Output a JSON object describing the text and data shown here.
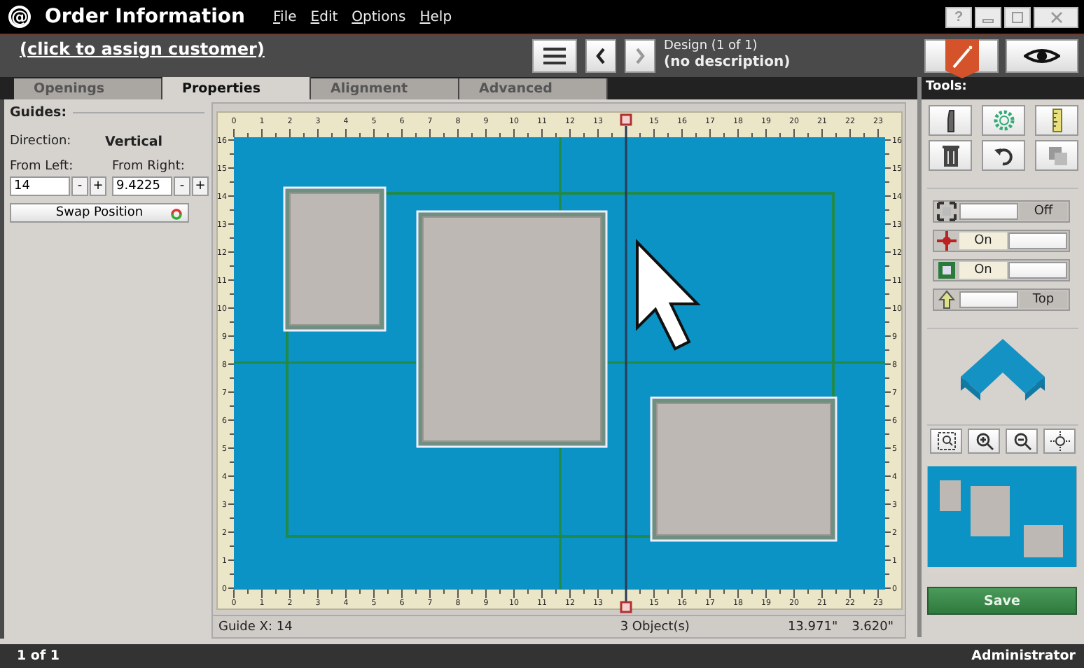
{
  "window": {
    "logo": "@",
    "title": "Order Information",
    "menu": [
      "File",
      "Edit",
      "Options",
      "Help"
    ],
    "help_button": "?"
  },
  "header": {
    "customer_link": "(click to assign customer)",
    "design_title": "Design  (1 of 1)",
    "design_description": "(no description)"
  },
  "tabs": [
    {
      "label": "Openings",
      "selected": false
    },
    {
      "label": "Properties",
      "selected": true
    },
    {
      "label": "Alignment",
      "selected": false
    },
    {
      "label": "Advanced",
      "selected": false
    }
  ],
  "guides": {
    "heading": "Guides:",
    "direction_label": "Direction:",
    "direction": "Vertical",
    "fields": [
      {
        "label": "From Left:",
        "value": "14",
        "minus": "-",
        "plus": "+"
      },
      {
        "label": "From Right:",
        "value": "9.4225",
        "minus": "-",
        "plus": "+"
      }
    ],
    "swap_button": "Swap Position"
  },
  "canvas": {
    "top_ruler": [
      "0",
      "1",
      "2",
      "3",
      "4",
      "5",
      "6",
      "7",
      "8",
      "9",
      "10",
      "11",
      "12",
      "13",
      "15",
      "16",
      "17",
      "18",
      "19",
      "20",
      "21",
      "22",
      "23"
    ],
    "bottom_ruler": [
      "0",
      "1",
      "2",
      "3",
      "4",
      "5",
      "6",
      "7",
      "8",
      "9",
      "10",
      "11",
      "12",
      "13",
      "15",
      "16",
      "17",
      "18",
      "19",
      "20",
      "21",
      "22",
      "23"
    ],
    "left_ruler": [
      "16",
      "15",
      "14",
      "13",
      "12",
      "11",
      "10",
      "9",
      "8",
      "7",
      "6",
      "5",
      "4",
      "3",
      "2",
      "1",
      "0"
    ],
    "right_ruler": [
      "16",
      "15",
      "14",
      "13",
      "12",
      "11",
      "10",
      "9",
      "8",
      "7",
      "6",
      "5",
      "4",
      "3",
      "2",
      "1",
      "0"
    ]
  },
  "status": {
    "guide": "Guide  X: 14",
    "objects": "3 Object(s)",
    "x_reading": "13.971\"",
    "y_reading": "3.620\""
  },
  "tools": {
    "heading": "Tools:",
    "toggles": [
      {
        "kind": "corners",
        "on": false,
        "label": "Off"
      },
      {
        "kind": "crosshair",
        "on": true,
        "label": "On"
      },
      {
        "kind": "frame",
        "on": true,
        "label": "On"
      },
      {
        "kind": "arrow",
        "on": false,
        "label": "Top"
      }
    ],
    "save_button": "Save"
  },
  "footer": {
    "page": "1 of 1",
    "user": "Administrator"
  }
}
